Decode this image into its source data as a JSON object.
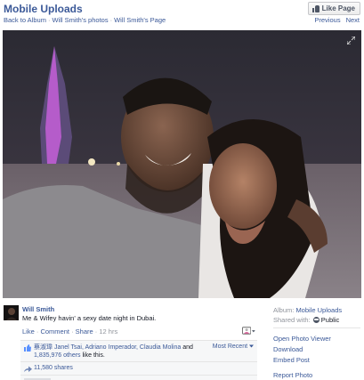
{
  "header": {
    "title": "Mobile Uploads",
    "like_page_label": "Like Page",
    "breadcrumbs": [
      "Back to Album",
      "Will Smith's photos",
      "Will Smith's Page"
    ],
    "pager": {
      "previous": "Previous",
      "next": "Next"
    }
  },
  "photo": {
    "icon": "expand-icon"
  },
  "post": {
    "author": "Will Smith",
    "caption": "Me & Wifey havin' a sexy date night in Dubai.",
    "actions": {
      "like": "Like",
      "comment": "Comment",
      "share": "Share",
      "time": "12 hrs"
    },
    "likes": {
      "names": "蔡淑瑋 Janel Tsai, Adriano Imperador, Claudia Molina",
      "and": "and",
      "others": "1,835,976 others",
      "suffix": "like this.",
      "sort": "Most Recent"
    },
    "shares": "11,580 shares"
  },
  "side": {
    "album_label": "Album:",
    "album_value": "Mobile Uploads",
    "shared_with_label": "Shared with:",
    "shared_with_value": "Public",
    "links": [
      "Open Photo Viewer",
      "Download",
      "Embed Post",
      "Report Photo"
    ]
  },
  "colors": {
    "link": "#3b5998",
    "muted": "#90949c",
    "text": "#141823"
  }
}
